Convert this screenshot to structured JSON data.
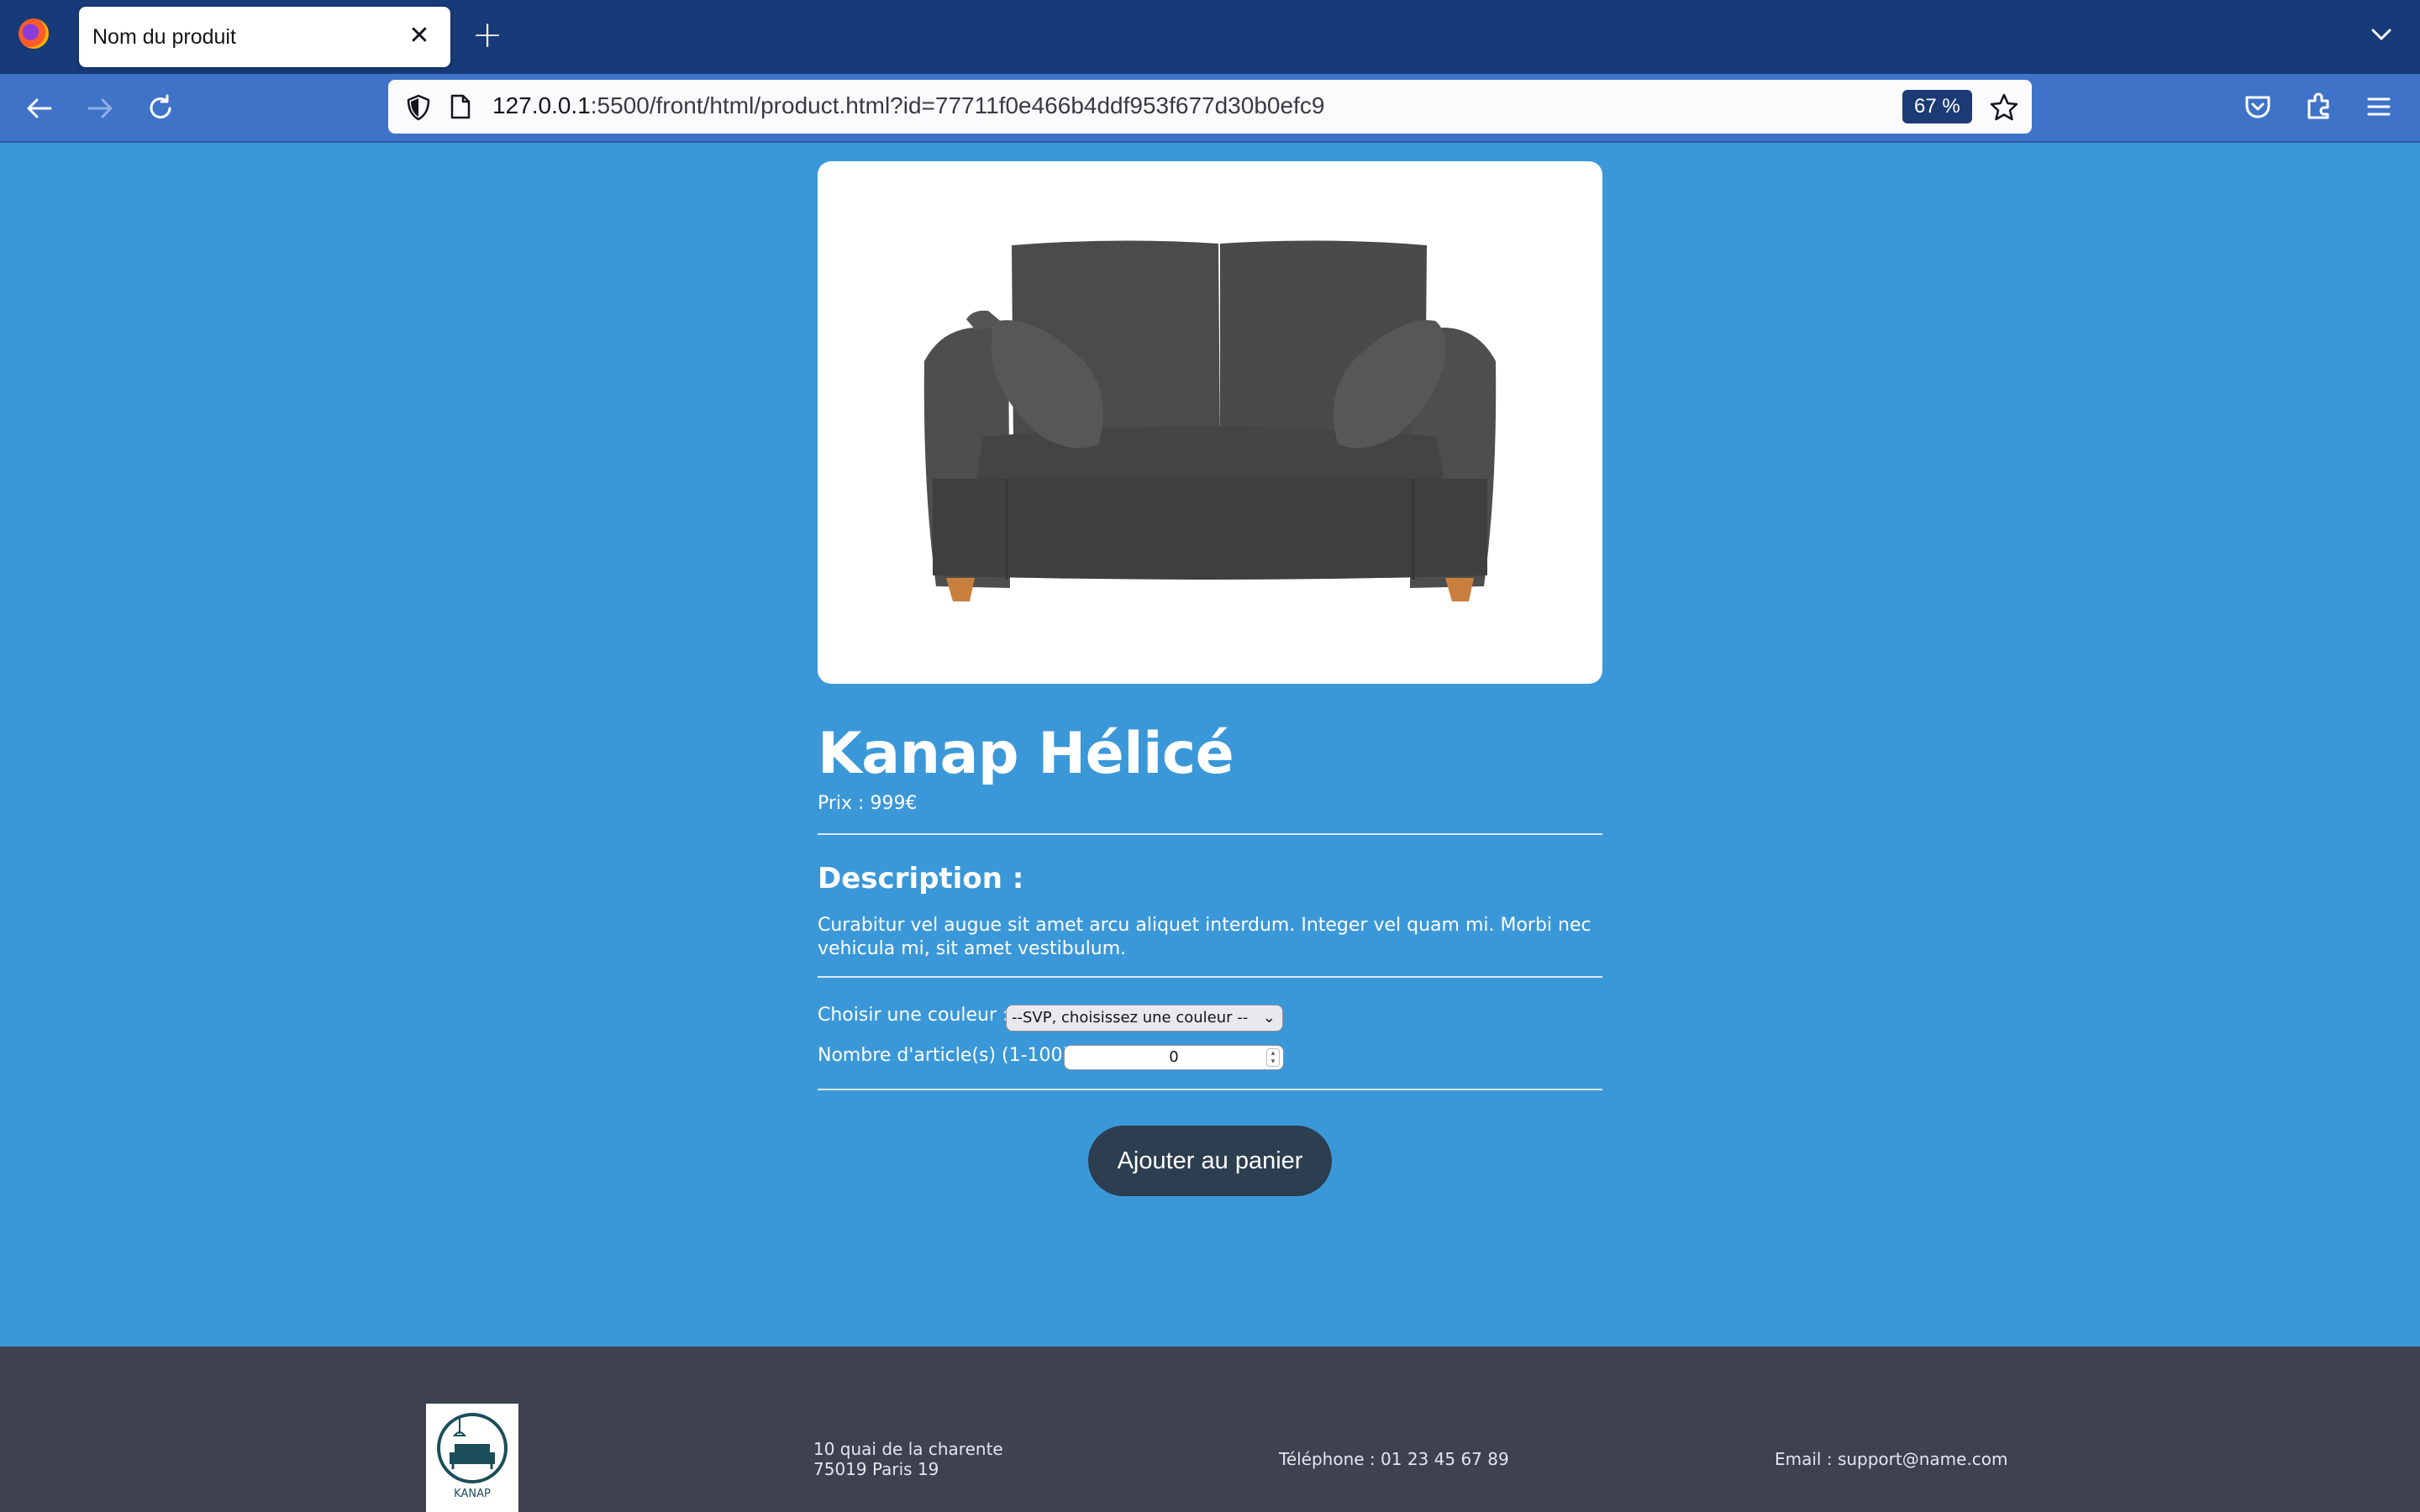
{
  "browser": {
    "tab_title": "Nom du produit",
    "url_host": "127.0.0.1",
    "url_rest": ":5500/front/html/product.html?id=77711f0e466b4ddf953f677d30b0efc9",
    "zoom": "67 %"
  },
  "product": {
    "title": "Kanap Hélicé",
    "price_label": "Prix : 999€",
    "description_heading": "Description :",
    "description": "Curabitur vel augue sit amet arcu aliquet interdum. Integer vel quam mi. Morbi nec vehicula mi, sit amet vestibulum.",
    "image_icon": "sofa-image"
  },
  "form": {
    "color_label": "Choisir une couleur :",
    "color_selected": "--SVP, choisissez une couleur --",
    "quantity_label": "Nombre d'article(s) (1-100) :",
    "quantity_value": "0",
    "add_button": "Ajouter au panier"
  },
  "footer": {
    "logo_text": "KANAP",
    "address_line1": "10 quai de la charente",
    "address_line2": "75019 Paris 19",
    "phone": "Téléphone : 01 23 45 67 89",
    "email": "Email : support@name.com"
  },
  "colors": {
    "page_bg": "#3b98d8",
    "tabbar_bg": "#173a78",
    "navbar_bg": "#3f73c8",
    "button_bg": "#2c3e50",
    "footer_bg": "#3d4150"
  }
}
